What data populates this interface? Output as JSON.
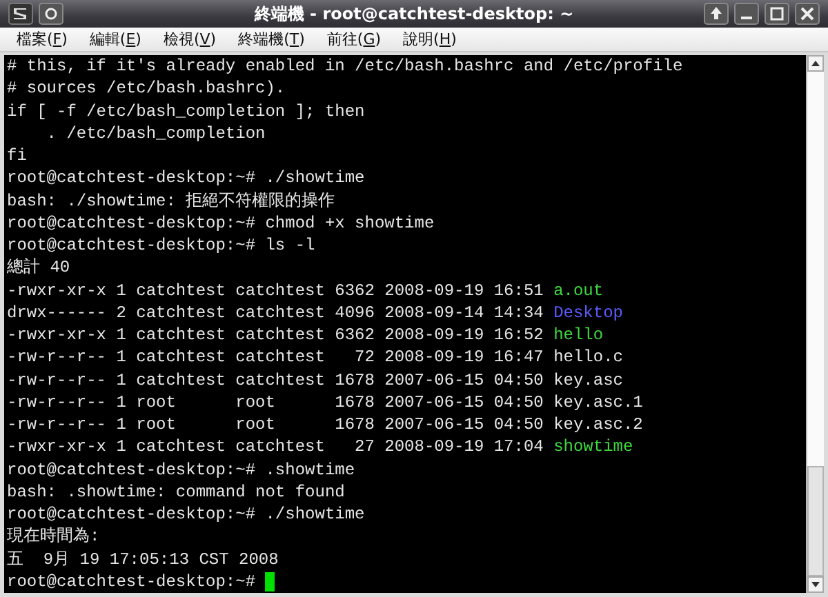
{
  "window": {
    "title": "終端機 - root@catchtest-desktop: ~"
  },
  "menu": [
    {
      "label": "檔案(F)"
    },
    {
      "label": "編輯(E)"
    },
    {
      "label": "檢視(V)"
    },
    {
      "label": "終端機(T)"
    },
    {
      "label": "前往(G)"
    },
    {
      "label": "說明(H)"
    }
  ],
  "terminal": {
    "cursor": true,
    "lines": [
      [
        {
          "text": "# this, if it's already enabled in /etc/bash.bashrc and /etc/profile",
          "kind": "plain"
        }
      ],
      [
        {
          "text": "# sources /etc/bash.bashrc).",
          "kind": "plain"
        }
      ],
      [
        {
          "text": "if [ -f /etc/bash_completion ]; then",
          "kind": "plain"
        }
      ],
      [
        {
          "text": "    . /etc/bash_completion",
          "kind": "plain"
        }
      ],
      [
        {
          "text": "fi",
          "kind": "plain"
        }
      ],
      [
        {
          "text": "root@catchtest-desktop:~# ./showtime",
          "kind": "plain"
        }
      ],
      [
        {
          "text": "bash: ./showtime: 拒絕不符權限的操作",
          "kind": "plain"
        }
      ],
      [
        {
          "text": "root@catchtest-desktop:~# chmod +x showtime",
          "kind": "plain"
        }
      ],
      [
        {
          "text": "root@catchtest-desktop:~# ls -l",
          "kind": "plain"
        }
      ],
      [
        {
          "text": "總計 40",
          "kind": "plain"
        }
      ],
      [
        {
          "text": "-rwxr-xr-x 1 catchtest catchtest 6362 2008-09-19 16:51 ",
          "kind": "plain"
        },
        {
          "text": "a.out",
          "kind": "exec"
        }
      ],
      [
        {
          "text": "drwx------ 2 catchtest catchtest 4096 2008-09-14 14:34 ",
          "kind": "plain"
        },
        {
          "text": "Desktop",
          "kind": "dir"
        }
      ],
      [
        {
          "text": "-rwxr-xr-x 1 catchtest catchtest 6362 2008-09-19 16:52 ",
          "kind": "plain"
        },
        {
          "text": "hello",
          "kind": "exec"
        }
      ],
      [
        {
          "text": "-rw-r--r-- 1 catchtest catchtest   72 2008-09-19 16:47 hello.c",
          "kind": "plain"
        }
      ],
      [
        {
          "text": "-rw-r--r-- 1 catchtest catchtest 1678 2007-06-15 04:50 key.asc",
          "kind": "plain"
        }
      ],
      [
        {
          "text": "-rw-r--r-- 1 root      root      1678 2007-06-15 04:50 key.asc.1",
          "kind": "plain"
        }
      ],
      [
        {
          "text": "-rw-r--r-- 1 root      root      1678 2007-06-15 04:50 key.asc.2",
          "kind": "plain"
        }
      ],
      [
        {
          "text": "-rwxr-xr-x 1 catchtest catchtest   27 2008-09-19 17:04 ",
          "kind": "plain"
        },
        {
          "text": "showtime",
          "kind": "exec"
        }
      ],
      [
        {
          "text": "root@catchtest-desktop:~# .showtime",
          "kind": "plain"
        }
      ],
      [
        {
          "text": "bash: .showtime: command not found",
          "kind": "plain"
        }
      ],
      [
        {
          "text": "root@catchtest-desktop:~# ./showtime",
          "kind": "plain"
        }
      ],
      [
        {
          "text": "現在時間為:",
          "kind": "plain"
        }
      ],
      [
        {
          "text": "五  9月 19 17:05:13 CST 2008",
          "kind": "plain"
        }
      ],
      [
        {
          "text": "root@catchtest-desktop:~# ",
          "kind": "plain"
        }
      ]
    ]
  }
}
